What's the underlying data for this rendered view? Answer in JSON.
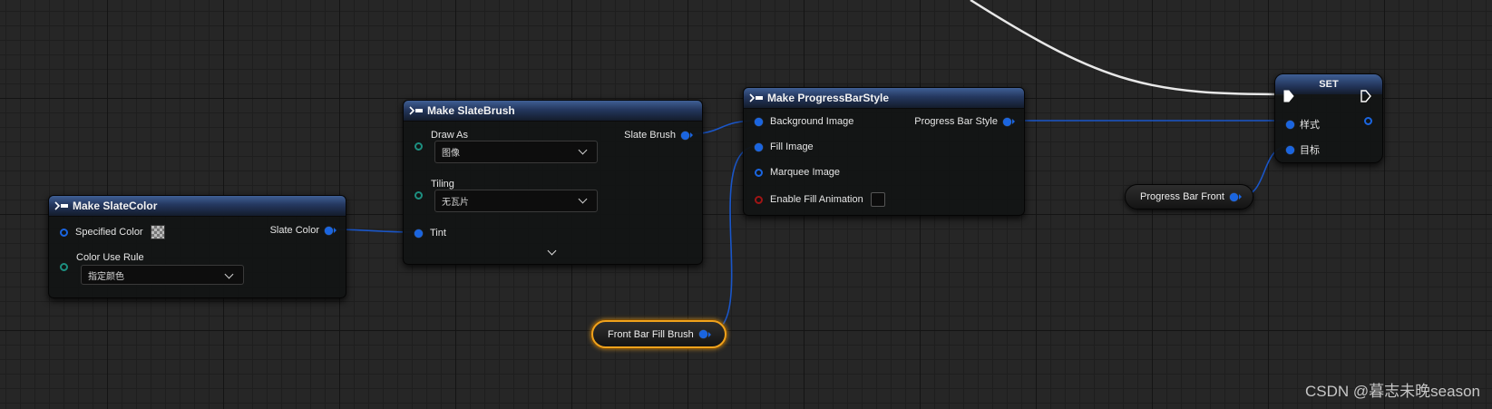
{
  "nodes": {
    "make_slate_color": {
      "title": "Make SlateColor",
      "specified_color_label": "Specified Color",
      "output_label": "Slate Color",
      "color_use_rule_label": "Color Use Rule",
      "color_use_rule_value": "指定颜色"
    },
    "make_slate_brush": {
      "title": "Make SlateBrush",
      "draw_as_label": "Draw As",
      "draw_as_value": "图像",
      "tiling_label": "Tiling",
      "tiling_value": "无瓦片",
      "tint_label": "Tint",
      "output_label": "Slate Brush"
    },
    "make_progress_bar_style": {
      "title": "Make ProgressBarStyle",
      "background_image_label": "Background Image",
      "fill_image_label": "Fill Image",
      "marquee_image_label": "Marquee Image",
      "enable_fill_animation_label": "Enable Fill Animation",
      "output_label": "Progress Bar Style"
    },
    "set_node": {
      "title": "SET",
      "style_label": "样式",
      "target_label": "目标"
    },
    "front_bar_fill_brush": {
      "label": "Front Bar Fill Brush"
    },
    "progress_bar_front": {
      "label": "Progress Bar Front"
    }
  },
  "colors": {
    "struct_pin": "#1a65e0",
    "exec_wire": "#e8e8e8",
    "selected_outline": "#f0a21c",
    "bool_pin": "#a01515",
    "enum_pin": "#1d8f80"
  },
  "icons": [
    "function-icon",
    "chevron-down-icon",
    "expand-chevron-icon",
    "exec-pin-icon"
  ],
  "watermark": "CSDN @暮志未晚season"
}
